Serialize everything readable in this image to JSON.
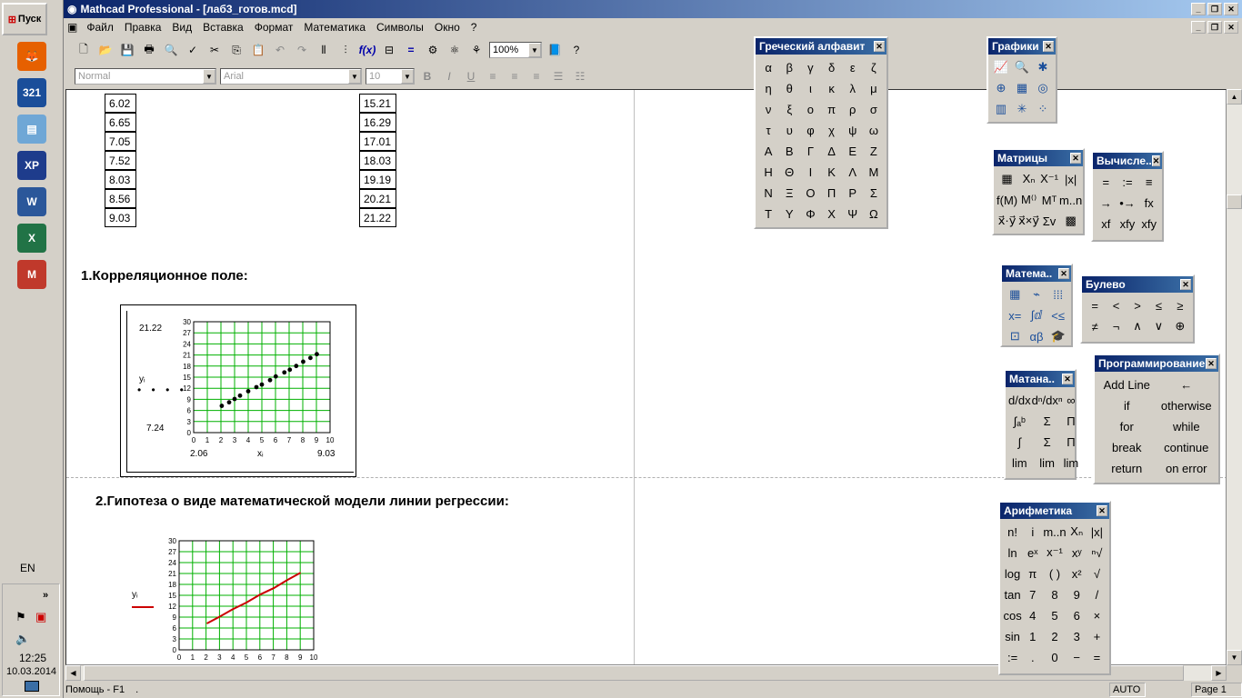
{
  "taskbar": {
    "start_label": "Пуск",
    "apps": [
      {
        "icon": "firefox-icon",
        "color": "#e66000",
        "glyph": "🦊"
      },
      {
        "icon": "media-player-321-icon",
        "color": "#1a4e9a",
        "glyph": "321"
      },
      {
        "icon": "disk-cleanup-icon",
        "color": "#6fa7d6",
        "glyph": "▤"
      },
      {
        "icon": "xp-floppy-icon",
        "color": "#1e3c8c",
        "glyph": "XP"
      },
      {
        "icon": "word-icon",
        "color": "#2b579a",
        "glyph": "W"
      },
      {
        "icon": "excel-icon",
        "color": "#217346",
        "glyph": "X"
      },
      {
        "icon": "mathcad-icon",
        "color": "#c0392b",
        "glyph": "M"
      }
    ],
    "lang": "EN",
    "time": "12:25",
    "date": "10.03.2014"
  },
  "window": {
    "title": "Mathcad Professional - [лаб3_готов.mcd]"
  },
  "menu": [
    "Файл",
    "Правка",
    "Вид",
    "Вставка",
    "Формат",
    "Математика",
    "Символы",
    "Окно",
    "?"
  ],
  "toolbar": {
    "zoom": "100%",
    "style": "Normal",
    "font": "Arial",
    "size": "10"
  },
  "document": {
    "col1": [
      "6.02",
      "6.65",
      "7.05",
      "7.52",
      "8.03",
      "8.56",
      "9.03"
    ],
    "col2": [
      "15.21",
      "16.29",
      "17.01",
      "18.03",
      "19.19",
      "20.21",
      "21.22"
    ],
    "section1": "1.Корреляционное поле:",
    "section2": "2.Гипотеза о виде математической модели линии регрессии:",
    "plot1": {
      "ymax_label": "21.22",
      "ymin_label": "7.24",
      "xmin_label": "2.06",
      "xmax_label": "9.03",
      "ylabel": "yᵢ",
      "xlabel": "xᵢ",
      "yticks": [
        "30",
        "27",
        "24",
        "21",
        "18",
        "15",
        "12",
        "9",
        "6",
        "3",
        "0"
      ],
      "xticks": [
        "0",
        "1",
        "2",
        "3",
        "4",
        "5",
        "6",
        "7",
        "8",
        "9",
        "10"
      ]
    },
    "plot2": {
      "ylabel": "yᵢ",
      "yticks": [
        "30",
        "27",
        "24",
        "21",
        "18",
        "15",
        "12",
        "9",
        "6",
        "3",
        "0"
      ],
      "xticks": [
        "0",
        "1",
        "2",
        "3",
        "4",
        "5",
        "6",
        "7",
        "8",
        "9",
        "10"
      ]
    }
  },
  "chart_data": [
    {
      "type": "scatter",
      "title": "",
      "xlabel": "xᵢ",
      "ylabel": "yᵢ",
      "xlim": [
        0,
        10
      ],
      "ylim": [
        0,
        30
      ],
      "grid": true,
      "x": [
        2.06,
        2.6,
        3.0,
        3.4,
        4.0,
        4.6,
        5.0,
        5.6,
        6.02,
        6.65,
        7.05,
        7.52,
        8.03,
        8.56,
        9.03
      ],
      "y": [
        7.24,
        8.2,
        9.1,
        10.0,
        11.2,
        12.3,
        13.0,
        14.2,
        15.21,
        16.29,
        17.01,
        18.03,
        19.19,
        20.21,
        21.22
      ],
      "color": "#000000"
    },
    {
      "type": "line",
      "title": "",
      "ylabel": "yᵢ",
      "xlim": [
        0,
        10
      ],
      "ylim": [
        0,
        30
      ],
      "grid": true,
      "x": [
        2.06,
        3.0,
        4.0,
        5.0,
        6.02,
        7.05,
        8.03,
        9.03
      ],
      "y": [
        7.24,
        9.1,
        11.2,
        13.0,
        15.21,
        17.01,
        19.19,
        21.22
      ],
      "color": "#cc0000"
    }
  ],
  "palettes": {
    "greek": {
      "title": "Греческий алфавит",
      "symbols": [
        "α",
        "β",
        "γ",
        "δ",
        "ε",
        "ζ",
        "η",
        "θ",
        "ι",
        "κ",
        "λ",
        "μ",
        "ν",
        "ξ",
        "ο",
        "π",
        "ρ",
        "σ",
        "τ",
        "υ",
        "φ",
        "χ",
        "ψ",
        "ω",
        "Α",
        "Β",
        "Γ",
        "Δ",
        "Ε",
        "Ζ",
        "Η",
        "Θ",
        "Ι",
        "Κ",
        "Λ",
        "Μ",
        "Ν",
        "Ξ",
        "Ο",
        "Π",
        "Ρ",
        "Σ",
        "Τ",
        "Υ",
        "Φ",
        "Χ",
        "Ψ",
        "Ω"
      ]
    },
    "graphs": {
      "title": "Графики",
      "symbols": [
        "📈",
        "🔍",
        "✱",
        "⊕",
        "▦",
        "◎",
        "▥",
        "✳",
        "⁘"
      ]
    },
    "matrices": {
      "title": "Матрицы",
      "symbols": [
        "▦",
        "Xₙ",
        "X⁻¹",
        "|x|",
        "f(M)",
        "M⁽⁾",
        "Mᵀ",
        "m..n",
        "x⃗·y⃗",
        "x⃗×y⃗",
        "Σv",
        "▩"
      ]
    },
    "evaluation": {
      "title": "Вычисле..",
      "symbols": [
        "=",
        ":=",
        "≡",
        "→",
        "•→",
        "fx",
        "xf",
        "xfy",
        "xfy"
      ]
    },
    "math": {
      "title": "Матема..",
      "symbols": [
        "▦",
        "⌁",
        "⁞⁞⁞",
        "x=",
        "∫ⅆ",
        "<≤",
        "⊡",
        "αβ",
        "🎓"
      ]
    },
    "boolean": {
      "title": "Булево",
      "symbols": [
        "=",
        "<",
        ">",
        "≤",
        "≥",
        "≠",
        "¬",
        "∧",
        "∨",
        "⊕"
      ]
    },
    "calculus": {
      "title": "Матана..",
      "symbols": [
        "d/dx",
        "dⁿ/dxⁿ",
        "∞",
        "∫ₐᵇ",
        "Σ",
        "Π",
        "∫",
        "Σ",
        "Π",
        "lim",
        "lim",
        "lim"
      ]
    },
    "programming": {
      "title": "Программирование",
      "items": [
        "Add Line",
        "←",
        "if",
        "otherwise",
        "for",
        "while",
        "break",
        "continue",
        "return",
        "on error"
      ]
    },
    "arithmetic": {
      "title": "Арифметика",
      "symbols": [
        "n!",
        "i",
        "m..n",
        "Xₙ",
        "|x|",
        "ln",
        "eˣ",
        "x⁻¹",
        "xʸ",
        "ⁿ√",
        "log",
        "π",
        "( )",
        "x²",
        "√",
        "tan",
        "7",
        "8",
        "9",
        "/",
        "cos",
        "4",
        "5",
        "6",
        "×",
        "sin",
        "1",
        "2",
        "3",
        "+",
        ":=",
        ".",
        "0",
        "−",
        "="
      ]
    }
  },
  "status": {
    "help": "Помощь - F1",
    "mode": "AUTO",
    "page": "Page 1"
  }
}
